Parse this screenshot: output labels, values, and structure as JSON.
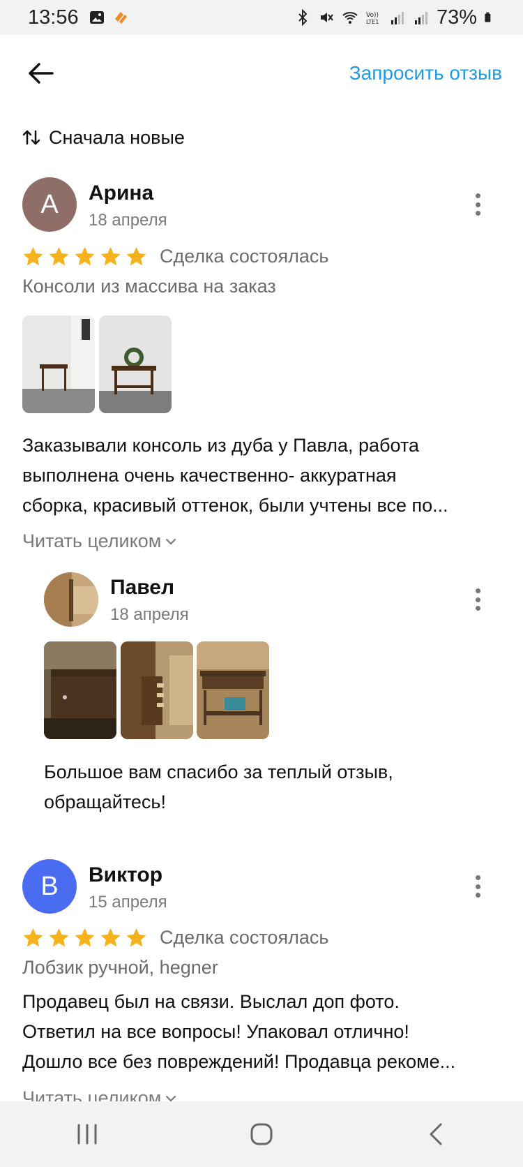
{
  "status": {
    "time": "13:56",
    "battery": "73%"
  },
  "appbar": {
    "request_label": "Запросить отзыв"
  },
  "sort": {
    "label": "Сначала новые"
  },
  "reviews": [
    {
      "avatar_letter": "А",
      "avatar_color": "#8e6e66",
      "name": "Арина",
      "date": "18 апреля",
      "rating": 5,
      "deal": "Сделка состоялась",
      "item": "Консоли из массива на заказ",
      "text_lines": [
        "Заказывали консоль из дуба у Павла, работа",
        "выполнена очень качественно- аккуратная",
        "сборка, красивый оттенок, были учтены все по..."
      ],
      "read_more": "Читать целиком",
      "reply": {
        "name": "Павел",
        "date": "18 апреля",
        "text_lines": [
          "Большое вам спасибо за теплый отзыв,",
          "обращайтесь!"
        ]
      }
    },
    {
      "avatar_letter": "В",
      "avatar_color": "#4a6cf0",
      "name": "Виктор",
      "date": "15 апреля",
      "rating": 5,
      "deal": "Сделка состоялась",
      "item": "Лобзик ручной, hegner",
      "text_lines": [
        "Продавец был на связи. Выслал доп фото.",
        "Ответил на все вопросы! Упаковал отлично!",
        "Дошло все без повреждений! Продавца рекоме..."
      ],
      "read_more": "Читать целиком"
    }
  ],
  "colors": {
    "accent": "#1f9be3",
    "star": "#f6b21b"
  }
}
